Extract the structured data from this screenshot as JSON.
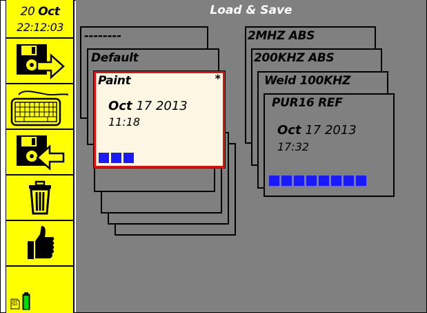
{
  "clock": {
    "day": "20",
    "month": "Oct",
    "time": "22:12:03"
  },
  "title": "Load & Save",
  "sidebar": {
    "buttons": [
      {
        "name": "save-to-disk-button",
        "icon": "floppy-arrow-out-icon"
      },
      {
        "name": "keyboard-button",
        "icon": "keyboard-icon"
      },
      {
        "name": "load-from-disk-button",
        "icon": "floppy-arrow-in-icon"
      },
      {
        "name": "delete-button",
        "icon": "trash-icon"
      },
      {
        "name": "confirm-button",
        "icon": "thumbs-up-icon"
      }
    ],
    "sd_label": "SD"
  },
  "left_stack": {
    "cards": [
      "--------",
      "Default"
    ],
    "front": {
      "name": "Paint",
      "modified_marker": "*",
      "date_month": "Oct",
      "date_rest": "17 2013",
      "time": "11:18",
      "blocks": 3
    }
  },
  "right_stack": {
    "cards": [
      "2MHZ ABS",
      "200KHZ ABS",
      "Weld 100KHZ"
    ],
    "front": {
      "name": "PUR16 REF",
      "date_month": "Oct",
      "date_rest": "17 2013",
      "time": "17:32",
      "blocks": 8
    }
  },
  "colors": {
    "sidebar": "#ffff00",
    "panel": "#808080",
    "selected_border": "#e01010",
    "block": "#1a1aff"
  }
}
